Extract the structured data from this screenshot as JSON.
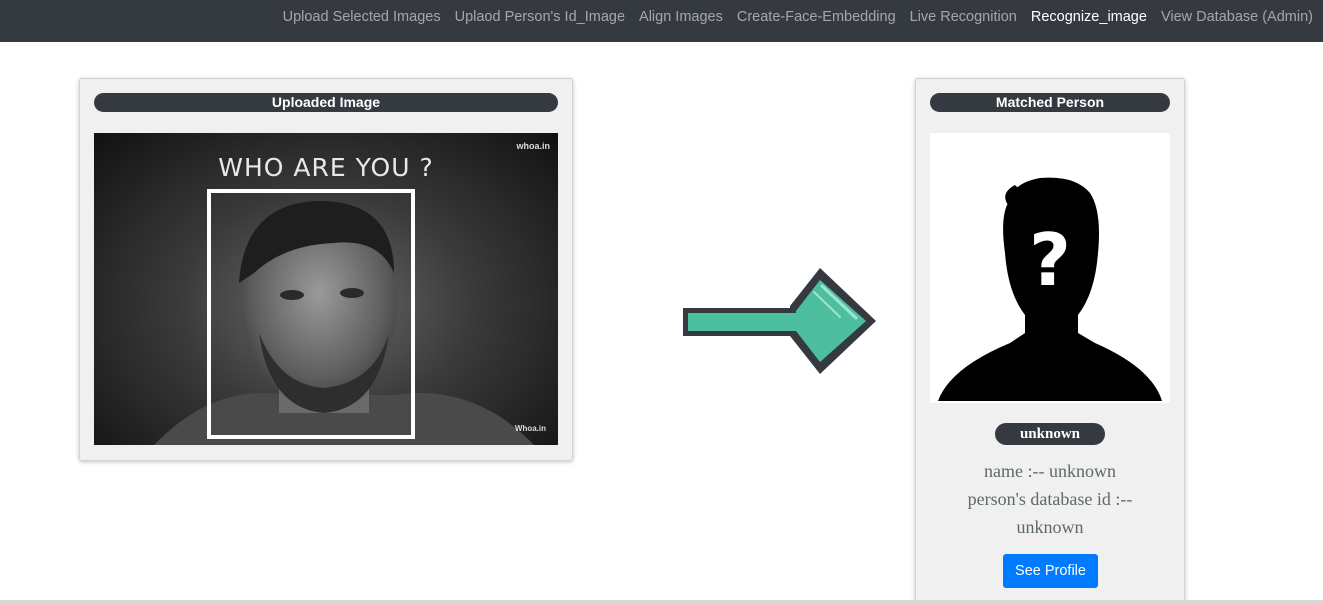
{
  "nav": {
    "links": [
      {
        "label": "Upload Selected Images"
      },
      {
        "label": "Uplaod Person's Id_Image"
      },
      {
        "label": "Align Images"
      },
      {
        "label": "Create-Face-Embedding"
      },
      {
        "label": "Live Recognition"
      },
      {
        "label": "Recognize_image"
      },
      {
        "label": "View Database (Admin)"
      }
    ],
    "active_index": 5
  },
  "uploaded": {
    "title": "Uploaded Image",
    "overlay_text": "WHO ARE YOU ?",
    "watermark_top": "whoa.in",
    "watermark_bottom": "Whoa.in"
  },
  "matched": {
    "title": "Matched Person",
    "badge": "unknown",
    "name_line": "name :-- unknown",
    "id_line_1": "person's database id :--",
    "id_line_2": "unknown",
    "see_profile_label": "See Profile"
  },
  "icons": {
    "arrow": "right-arrow-icon",
    "silhouette": "unknown-person-icon"
  },
  "colors": {
    "navbar": "#343a40",
    "arrow_fill": "#4dbf9e",
    "button": "#007bff"
  }
}
